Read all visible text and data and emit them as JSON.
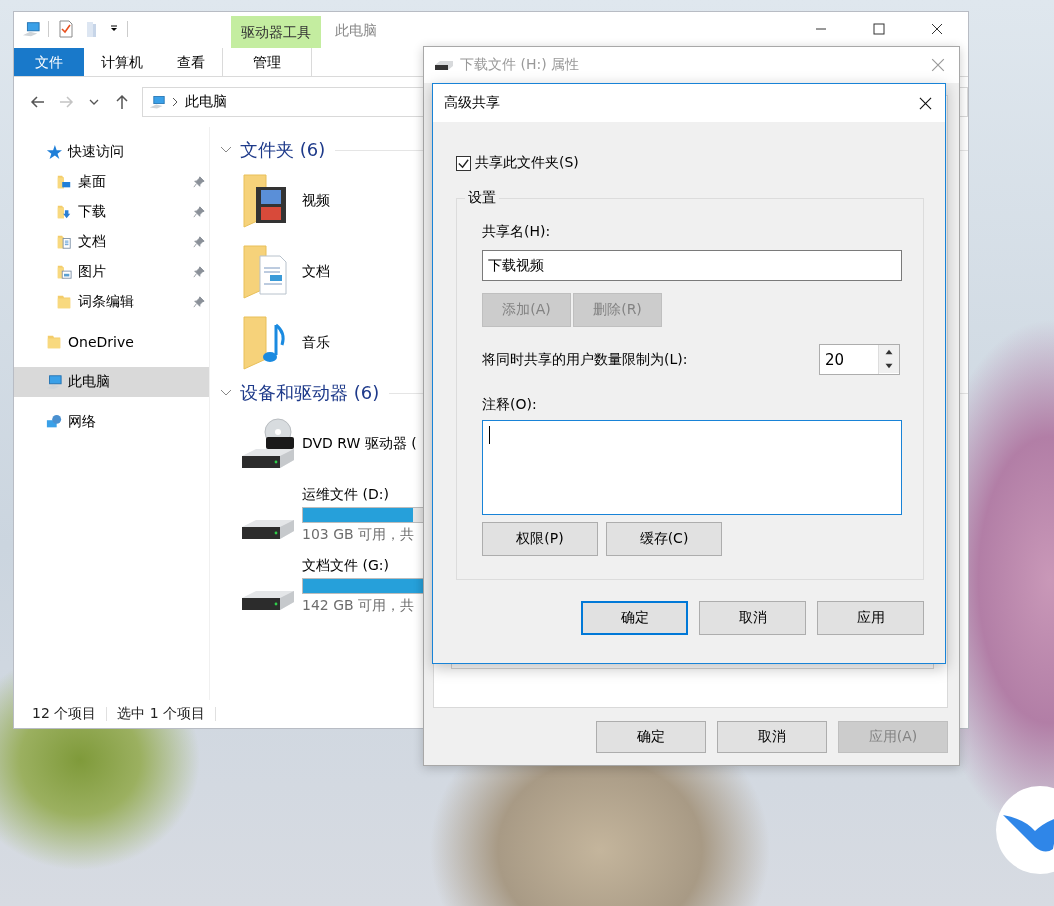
{
  "explorer": {
    "title": "此电脑",
    "context_group": "驱动器工具",
    "ribbon_tabs": [
      {
        "label": "文件",
        "kind": "file"
      },
      {
        "label": "计算机",
        "kind": "tab"
      },
      {
        "label": "查看",
        "kind": "tab"
      },
      {
        "label": "管理",
        "kind": "context"
      }
    ],
    "nav_buttons": [
      {
        "kind": "back",
        "disabled": false
      },
      {
        "kind": "forward",
        "disabled": true
      },
      {
        "kind": "recent",
        "disabled": false
      },
      {
        "kind": "up",
        "disabled": false
      }
    ],
    "address": {
      "path": "此电脑"
    },
    "sidebar": {
      "items": [
        {
          "label": "快速访问",
          "kind": "star",
          "selected": false,
          "children": [
            {
              "label": "桌面",
              "kind": "desktop",
              "pinned": true,
              "selected": false
            },
            {
              "label": "下载",
              "kind": "download",
              "pinned": true,
              "selected": false
            },
            {
              "label": "文档",
              "kind": "document",
              "pinned": true,
              "selected": false
            },
            {
              "label": "图片",
              "kind": "picture",
              "pinned": true,
              "selected": false
            },
            {
              "label": "词条编辑",
              "kind": "folder",
              "pinned": true,
              "selected": false
            }
          ]
        },
        {
          "label": "OneDrive",
          "kind": "folder",
          "selected": false
        },
        {
          "label": "此电脑",
          "kind": "pc",
          "selected": true
        },
        {
          "label": "网络",
          "kind": "network",
          "selected": false
        }
      ]
    },
    "sections": [
      {
        "title": "文件夹 (6)",
        "items": [
          {
            "label": "视频",
            "kind": "video"
          },
          {
            "label": "文档",
            "kind": "document"
          },
          {
            "label": "音乐",
            "kind": "music"
          }
        ]
      },
      {
        "title": "设备和驱动器 (6)",
        "items": [
          {
            "label": "DVD RW 驱动器 (",
            "kind": "dvd"
          },
          {
            "label": "运维文件 (D:)",
            "kind": "disk",
            "level": 0.6,
            "free": "103 GB 可用，共"
          },
          {
            "label": "文档文件 (G:)",
            "kind": "disk",
            "level": 0.75,
            "free": "142 GB 可用，共"
          }
        ]
      }
    ],
    "status_bar": [
      "12 个项目",
      "选中 1 个项目"
    ]
  },
  "properties": {
    "title": "下载文件 (H:) 属性",
    "buttons": [
      {
        "label": "确定",
        "disabled": false
      },
      {
        "label": "取消",
        "disabled": false
      },
      {
        "label": "应用(A)",
        "disabled": true
      }
    ]
  },
  "dialog": {
    "title": "高级共享",
    "share_checkbox": {
      "label": "共享此文件夹(S)",
      "checked": true
    },
    "group": "设置",
    "share_name_label": "共享名(H):",
    "share_name": "下载视频",
    "name_buttons": [
      {
        "label": "添加(A)",
        "disabled": true
      },
      {
        "label": "删除(R)",
        "disabled": true
      }
    ],
    "limit_label": "将同时共享的用户数量限制为(L):",
    "limit_value": "20",
    "comment_label": "注释(O):",
    "comment_focused": true,
    "action_buttons": [
      {
        "label": "权限(P)",
        "disabled": false
      },
      {
        "label": "缓存(C)",
        "disabled": false
      }
    ],
    "buttons": [
      {
        "label": "确定",
        "default": true
      },
      {
        "label": "取消",
        "default": false
      },
      {
        "label": "应用",
        "default": false
      }
    ]
  }
}
